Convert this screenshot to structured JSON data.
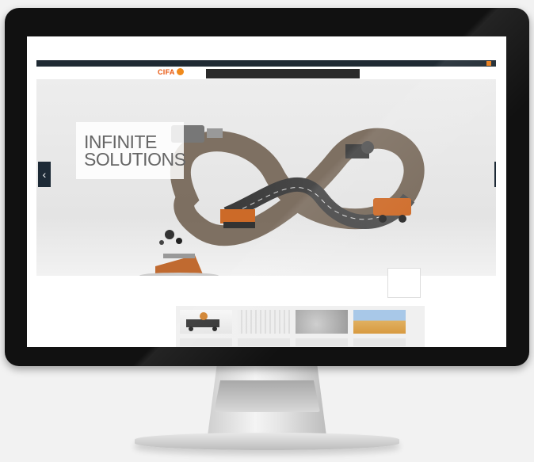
{
  "topbar": {
    "links": [
      "",
      "",
      "",
      "",
      "",
      ""
    ],
    "selected_index": 1
  },
  "header": {
    "logo_text": "CIFA",
    "nav_items": [
      "",
      "",
      "",
      "",
      "",
      ""
    ]
  },
  "hero": {
    "title_line1": "INFINITE",
    "title_line2": "SOLUTIONS",
    "subtitle": ""
  },
  "ad": {
    "line1": "",
    "line2": "",
    "line3": ""
  },
  "tiles": [
    {
      "label": ""
    },
    {
      "label": ""
    },
    {
      "label": ""
    },
    {
      "label": ""
    }
  ],
  "colors": {
    "brand_orange": "#e8550c",
    "nav_dark": "#2b2b2b",
    "arrow_navy": "#1d2a36"
  }
}
